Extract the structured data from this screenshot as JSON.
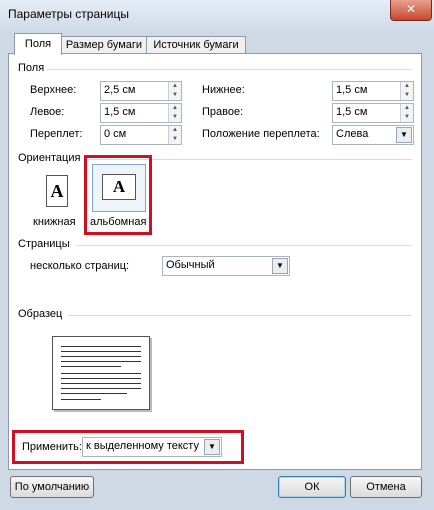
{
  "window": {
    "title": "Параметры страницы",
    "close_glyph": "✕"
  },
  "tabs": [
    {
      "label": "Поля",
      "active": true
    },
    {
      "label": "Размер бумаги",
      "active": false
    },
    {
      "label": "Источник бумаги",
      "active": false
    }
  ],
  "margins": {
    "section_label": "Поля",
    "top_label": "Верхнее:",
    "top_value": "2,5 см",
    "bottom_label": "Нижнее:",
    "bottom_value": "1,5 см",
    "left_label": "Левое:",
    "left_value": "1,5 см",
    "right_label": "Правое:",
    "right_value": "1,5 см",
    "gutter_label": "Переплет:",
    "gutter_value": "0 см",
    "gutter_pos_label": "Положение переплета:",
    "gutter_pos_value": "Слева"
  },
  "orientation": {
    "section_label": "Ориентация",
    "portrait_label": "книжная",
    "landscape_label": "альбомная",
    "selected": "landscape",
    "glyph": "A",
    "highlight_color": "#d01020"
  },
  "pages": {
    "section_label": "Страницы",
    "multiple_label": "несколько страниц:",
    "multiple_value": "Обычный"
  },
  "preview": {
    "section_label": "Образец"
  },
  "apply": {
    "label": "Применить:",
    "value": "к выделенному тексту"
  },
  "buttons": {
    "default_label": "По умолчанию",
    "ok_label": "ОК",
    "cancel_label": "Отмена"
  },
  "icons": {
    "spin_up": "▲",
    "spin_down": "▼",
    "dropdown": "▼"
  }
}
